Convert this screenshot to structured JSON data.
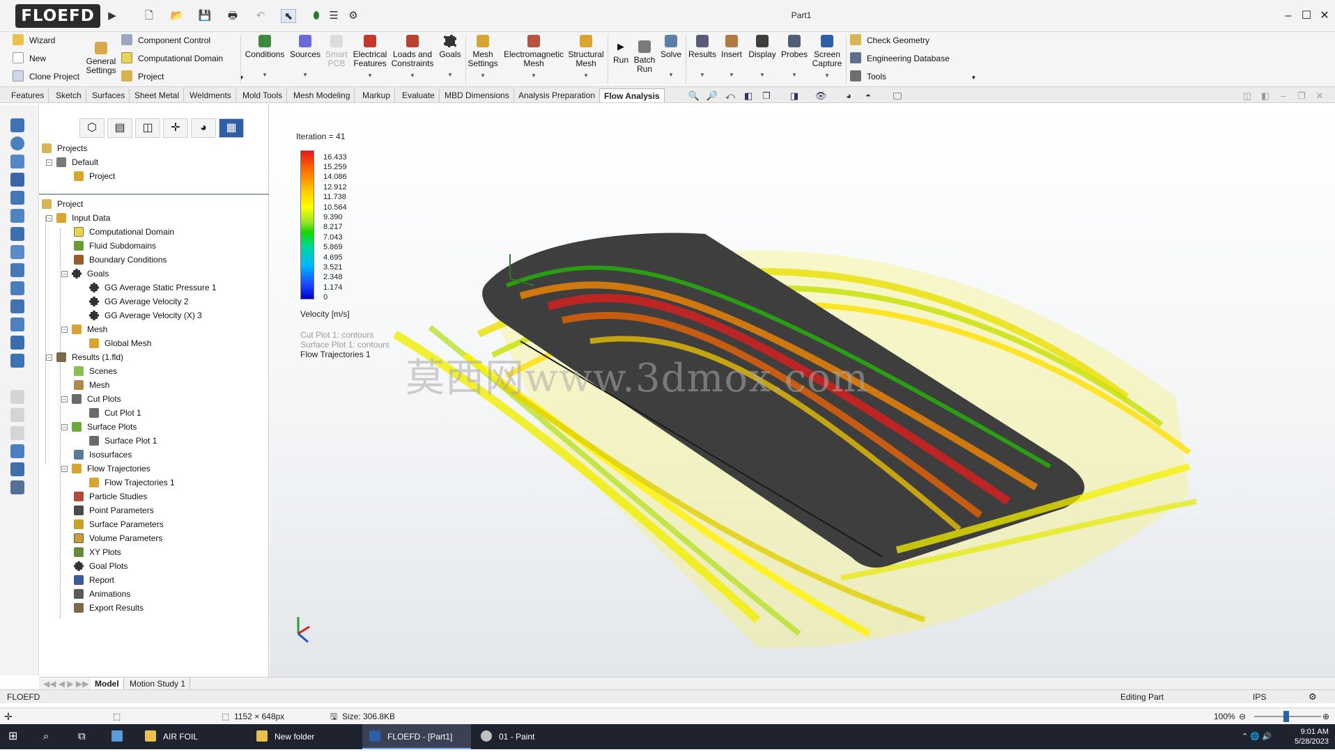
{
  "app": {
    "logo": "FLOEFD",
    "doc_title": "Part1"
  },
  "ribbon": {
    "wizard": "Wizard",
    "new": "New",
    "clone_project": "Clone Project",
    "general_settings": "General Settings",
    "component_control": "Component Control",
    "computational_domain": "Computational Domain",
    "project": "Project",
    "conditions": "Conditions",
    "sources": "Sources",
    "smart_pcb": "Smart PCB",
    "electrical_features": "Electrical Features",
    "loads_constraints": "Loads and Constraints",
    "goals": "Goals",
    "mesh_settings": "Mesh Settings",
    "electromagnetic_mesh": "Electromagnetic Mesh",
    "structural_mesh": "Structural Mesh",
    "run": "Run",
    "batch_run": "Batch Run",
    "solve": "Solve",
    "results": "Results",
    "insert": "Insert",
    "display": "Display",
    "probes": "Probes",
    "screen_capture": "Screen Capture",
    "check_geometry": "Check Geometry",
    "engineering_database": "Engineering Database",
    "tools": "Tools"
  },
  "tabs": [
    "Features",
    "Sketch",
    "Surfaces",
    "Sheet Metal",
    "Weldments",
    "Mold Tools",
    "Mesh Modeling",
    "Markup",
    "Evaluate",
    "MBD Dimensions",
    "Analysis Preparation",
    "Flow Analysis"
  ],
  "tree_top": {
    "projects": "Projects",
    "default": "Default",
    "project": "Project"
  },
  "tree": {
    "project": "Project",
    "input_data": "Input Data",
    "computational_domain": "Computational Domain",
    "fluid_subdomains": "Fluid Subdomains",
    "boundary_conditions": "Boundary Conditions",
    "goals": "Goals",
    "goal1": "GG Average Static Pressure 1",
    "goal2": "GG Average Velocity 2",
    "goal3": "GG Average Velocity (X) 3",
    "mesh": "Mesh",
    "global_mesh": "Global Mesh",
    "results": "Results (1.fld)",
    "scenes": "Scenes",
    "results_mesh": "Mesh",
    "cut_plots": "Cut Plots",
    "cut_plot_1": "Cut Plot 1",
    "surface_plots": "Surface Plots",
    "surface_plot_1": "Surface Plot 1",
    "isosurfaces": "Isosurfaces",
    "flow_trajectories": "Flow Trajectories",
    "flow_trajectories_1": "Flow Trajectories 1",
    "particle_studies": "Particle Studies",
    "point_parameters": "Point Parameters",
    "surface_parameters": "Surface Parameters",
    "volume_parameters": "Volume Parameters",
    "xy_plots": "XY Plots",
    "goal_plots": "Goal Plots",
    "report": "Report",
    "animations": "Animations",
    "export_results": "Export Results"
  },
  "viewport": {
    "iteration": "Iteration = 41",
    "legend_values": [
      "16.433",
      "15.259",
      "14.086",
      "12.912",
      "11.738",
      "10.564",
      "9.390",
      "8.217",
      "7.043",
      "5.869",
      "4.695",
      "3.521",
      "2.348",
      "1.174",
      "0"
    ],
    "legend_title": "Velocity [m/s]",
    "plot1": "Cut Plot 1: contours",
    "plot2": "Surface Plot 1: contours",
    "plot3": "Flow Trajectories 1",
    "watermark": "莫西网www.3dmox.com"
  },
  "bottom_tabs": {
    "model": "Model",
    "motion_study": "Motion Study 1"
  },
  "status": {
    "app": "FLOEFD",
    "mode": "Editing Part",
    "units": "IPS",
    "dims": "1152 × 648px",
    "size": "Size: 306.8KB",
    "zoom": "100%"
  },
  "taskbar": {
    "airfoil": "AIR FOIL",
    "new_folder": "New folder",
    "floefd": "FLOEFD - [Part1]",
    "paint": "01 - Paint",
    "time": "9:01 AM",
    "date": "5/28/2023"
  },
  "colors": {
    "accent": "#2d5fa6",
    "streamline_high": "#e31a1c",
    "streamline_mid": "#ffd000",
    "streamline_low": "#19d600"
  }
}
